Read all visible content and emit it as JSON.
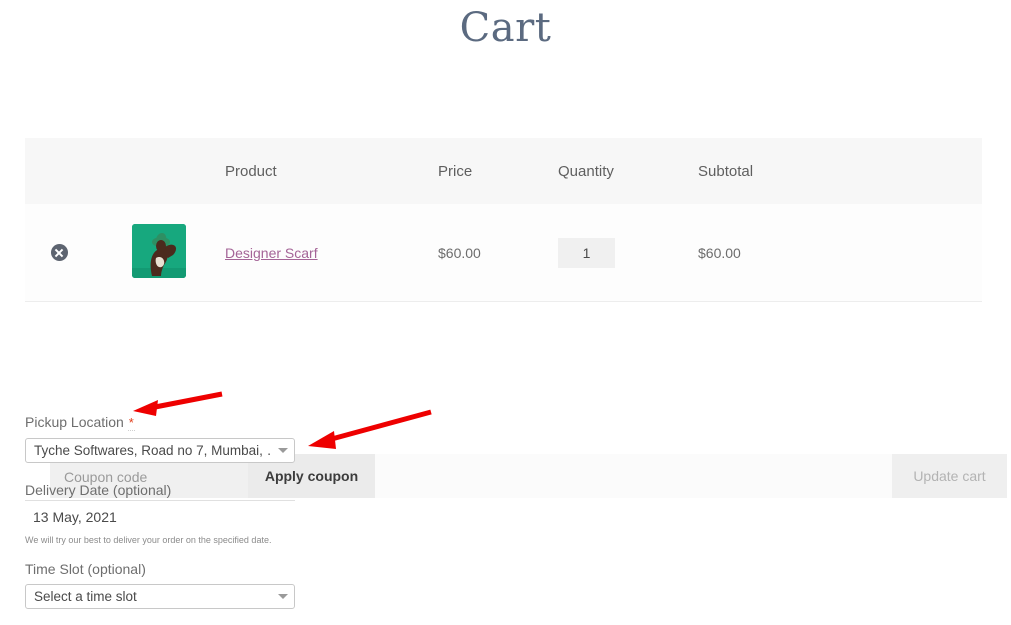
{
  "page": {
    "title": "Cart"
  },
  "cart": {
    "columns": [
      "",
      "",
      "Product",
      "Price",
      "Quantity",
      "Subtotal"
    ],
    "headers": {
      "product": "Product",
      "price": "Price",
      "quantity": "Quantity",
      "subtotal": "Subtotal"
    },
    "items": [
      {
        "remove_icon": "remove-circle-icon",
        "thumbnail_icon": "product-thumbnail-image",
        "name": "Designer Scarf",
        "price": "$60.00",
        "quantity": "1",
        "subtotal": "$60.00"
      }
    ]
  },
  "actions": {
    "coupon_placeholder": "Coupon code",
    "coupon_value": "",
    "apply_label": "Apply coupon",
    "update_label": "Update cart"
  },
  "pickup": {
    "label": "Pickup Location",
    "required_mark": "*",
    "selected": "Tyche Softwares, Road no 7, Mumbai, …",
    "caret_icon": "chevron-down-icon"
  },
  "delivery": {
    "label": "Delivery Date (optional)",
    "value": "13 May, 2021",
    "help": "We will try our best to deliver your order on the specified date."
  },
  "timeslot": {
    "label": "Time Slot (optional)",
    "selected": "Select a time slot",
    "caret_icon": "chevron-down-icon"
  },
  "colors": {
    "accent_link": "#a46497",
    "required": "#e2401c",
    "annotation_arrow": "#ee0000",
    "thumb_background": "#17a87e",
    "title": "#5b6a80"
  },
  "annotations": [
    {
      "name": "arrow-to-pickup-label",
      "icon": "red-arrow-icon"
    },
    {
      "name": "arrow-to-pickup-select",
      "icon": "red-arrow-icon"
    }
  ]
}
